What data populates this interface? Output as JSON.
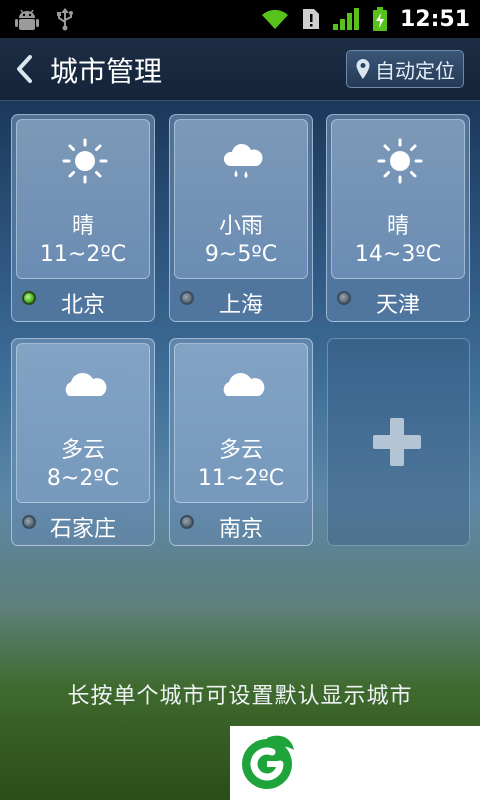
{
  "status_bar": {
    "time": "12:51"
  },
  "header": {
    "title": "城市管理",
    "locate_label": "自动定位"
  },
  "cities": [
    {
      "condition": "晴",
      "temp": "11~2ºC",
      "name": "北京",
      "icon": "sun-icon",
      "default": true
    },
    {
      "condition": "小雨",
      "temp": "9~5ºC",
      "name": "上海",
      "icon": "light-rain-icon",
      "default": false
    },
    {
      "condition": "晴",
      "temp": "14~3ºC",
      "name": "天津",
      "icon": "sun-icon",
      "default": false
    },
    {
      "condition": "多云",
      "temp": "8~2ºC",
      "name": "石家庄",
      "icon": "cloud-icon",
      "default": false
    },
    {
      "condition": "多云",
      "temp": "11~2ºC",
      "name": "南京",
      "icon": "cloud-icon",
      "default": false
    }
  ],
  "hint": "长按单个城市可设置默认显示城市",
  "colors": {
    "active_dot": "#3fae19",
    "ad_logo": "#1fa33b"
  }
}
